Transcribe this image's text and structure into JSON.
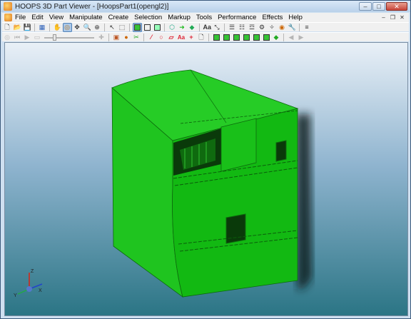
{
  "window": {
    "title": "HOOPS 3D Part Viewer - [HoopsPart1(opengl2)]",
    "controls": {
      "minimize": "–",
      "maximize": "□",
      "close": "✕"
    }
  },
  "menubar": {
    "items": [
      "File",
      "Edit",
      "View",
      "Manipulate",
      "Create",
      "Selection",
      "Markup",
      "Tools",
      "Performance",
      "Effects",
      "Help"
    ],
    "mdi_controls": {
      "minimize": "–",
      "restore": "❐",
      "close": "✕"
    }
  },
  "toolbar_row1": {
    "icons": [
      "new-icon",
      "open-icon",
      "save-icon",
      "grid-icon",
      "orbit-icon",
      "walk-icon",
      "pan-icon",
      "zoom-icon",
      "zoom-window-icon",
      "select-icon",
      "select-area-icon",
      "shaded-icon",
      "hidden-line-icon",
      "render-icon",
      "text-icon",
      "measure-icon",
      "layer-icon",
      "frame-icon",
      "slice-icon",
      "smooth-icon",
      "color-icon",
      "settings-icon",
      "list-icon"
    ]
  },
  "toolbar_row2": {
    "icons": [
      "first-frame-icon",
      "prev-frame-icon",
      "play-icon",
      "stop-icon",
      "animation-slider",
      "next-icon",
      "annotate-icon",
      "cut-icon",
      "markup-pen-icon",
      "markup-circle-icon",
      "markup-rect-icon",
      "markup-text-icon",
      "add-icon",
      "page-icon",
      "cube-front-icon",
      "cube-back-icon",
      "cube-left-icon",
      "cube-right-icon",
      "cube-top-icon",
      "cube-bottom-icon",
      "cube-iso-icon",
      "back-arrow-icon",
      "forward-arrow-icon"
    ],
    "slider_value": 0.2
  },
  "viewport": {
    "background_top": "#e9f0f7",
    "background_bottom": "#2b7585",
    "model_color": "#19c219",
    "axis_labels": [
      "Z",
      "Y",
      "X"
    ]
  }
}
